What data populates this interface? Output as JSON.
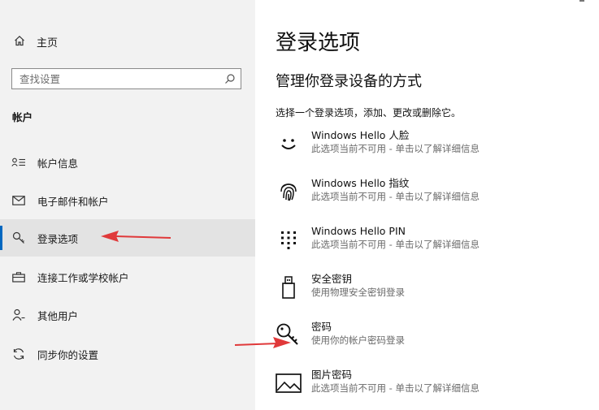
{
  "sidebar": {
    "home_label": "主页",
    "search_placeholder": "查找设置",
    "section_title": "帐户",
    "items": [
      {
        "label": "帐户信息",
        "icon": "account-info-icon"
      },
      {
        "label": "电子邮件和帐户",
        "icon": "mail-icon"
      },
      {
        "label": "登录选项",
        "icon": "key-icon",
        "active": true
      },
      {
        "label": "连接工作或学校帐户",
        "icon": "briefcase-icon"
      },
      {
        "label": "其他用户",
        "icon": "person-add-icon"
      },
      {
        "label": "同步你的设置",
        "icon": "sync-icon"
      }
    ]
  },
  "main": {
    "title": "登录选项",
    "subtitle": "管理你登录设备的方式",
    "intro": "选择一个登录选项，添加、更改或删除它。",
    "options": [
      {
        "name": "Windows Hello 人脸",
        "desc": "此选项当前不可用 - 单击以了解详细信息",
        "icon": "face-icon"
      },
      {
        "name": "Windows Hello 指纹",
        "desc": "此选项当前不可用 - 单击以了解详细信息",
        "icon": "fingerprint-icon"
      },
      {
        "name": "Windows Hello PIN",
        "desc": "此选项当前不可用 - 单击以了解详细信息",
        "icon": "pin-keypad-icon"
      },
      {
        "name": "安全密钥",
        "desc": "使用物理安全密钥登录",
        "icon": "usb-key-icon"
      },
      {
        "name": "密码",
        "desc": "使用你的帐户密码登录",
        "icon": "password-key-icon"
      },
      {
        "name": "图片密码",
        "desc": "此选项当前不可用 - 单击以了解详细信息",
        "icon": "picture-icon"
      }
    ]
  },
  "colors": {
    "accent": "#0067c0",
    "annotation_arrow": "#e0393a",
    "sidebar_bg": "#f2f2f2",
    "active_bg": "#e3e3e3"
  }
}
